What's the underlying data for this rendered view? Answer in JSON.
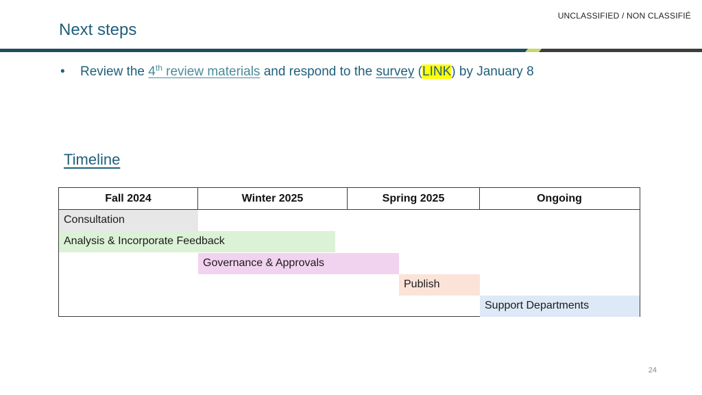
{
  "header": {
    "classification": "UNCLASSIFIED / NON CLASSIFIÉ",
    "title": "Next steps"
  },
  "bullet": {
    "marker": "•",
    "text_before": "Review the ",
    "ordinal_num": "4",
    "ordinal_suffix": "th",
    "review_link": " review materials",
    "text_middle": " and respond to the ",
    "survey_link": "survey",
    "paren_open": " (",
    "highlight_link": "LINK",
    "text_after": ") by January 8"
  },
  "timeline": {
    "heading": "Timeline",
    "columns": [
      "Fall 2024",
      "Winter 2025",
      "Spring 2025",
      "Ongoing"
    ],
    "bars": [
      {
        "label": "Consultation",
        "color": "#e7e7e7"
      },
      {
        "label": "Analysis & Incorporate Feedback",
        "color": "#dcf2d6"
      },
      {
        "label": "Governance & Approvals",
        "color": "#f2d3ef"
      },
      {
        "label": "Publish",
        "color": "#fbe3d8"
      },
      {
        "label": "Support Departments",
        "color": "#dde9f6"
      }
    ]
  },
  "colors": {
    "title": "#1f5f7a",
    "rule_teal": "#1d4e5e",
    "rule_accent": "#c8d66e",
    "rule_dark": "#3d3d3d"
  },
  "footer": {
    "page_number": "24"
  }
}
